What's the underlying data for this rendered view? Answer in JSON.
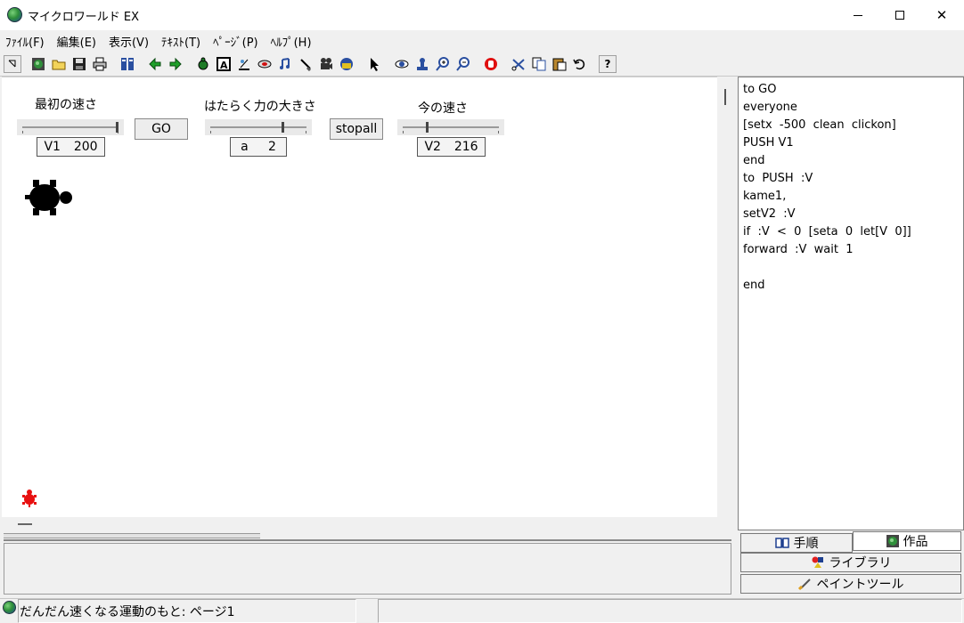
{
  "window": {
    "title": "マイクロワールド EX"
  },
  "menu": [
    "ﾌｧｲﾙ(F)",
    "編集(E)",
    "表示(V)",
    "ﾃｷｽﾄ(T)",
    "ﾍﾟｰｼﾞ(P)",
    "ﾍﾙﾌﾟ(H)"
  ],
  "toolbar": {
    "icons": [
      "pointer-back-icon",
      "globe-icon",
      "open-folder-icon",
      "save-icon",
      "print-icon",
      "pages-icon",
      "arrow-left-icon",
      "arrow-right-icon",
      "new-turtle-icon",
      "text-box-icon",
      "slider-tool-icon",
      "button-tool-icon",
      "music-icon",
      "paint-brush-icon",
      "video-icon",
      "record-icon",
      "select-arrow-icon",
      "eye-icon",
      "stamp-icon",
      "zoom-in-icon",
      "zoom-out-icon",
      "stop-icon",
      "scissors-icon",
      "copy-icon",
      "paste-icon",
      "undo-icon",
      "help-icon"
    ],
    "help_glyph": "?"
  },
  "canvas": {
    "slider1": {
      "label": "最初の速さ",
      "name": "V1",
      "value": "200",
      "level": 0.98
    },
    "go_button": "GO",
    "slider2": {
      "label": "はたらく力の大きさ",
      "name": "a",
      "value": "2",
      "level": 0.75
    },
    "stopall_button": "stopall",
    "slider3": {
      "label": "今の速さ",
      "name": "V2",
      "value": "216",
      "level": 0.25
    }
  },
  "procedures": [
    "to GO",
    "everyone",
    "[setx  -500  clean  clickon]",
    "PUSH V1",
    "end",
    "to  PUSH  :V",
    "kame1,",
    "setV2  :V",
    "if  :V  <  0  [seta  0  let[V  0]]",
    "forward  :V  wait  1",
    "",
    "end"
  ],
  "tabs": {
    "procedures_tab": "手順",
    "project_tab": "作品",
    "library_tab": "ライブラリ",
    "paint_tab": "ペイントツール"
  },
  "status": {
    "text": "だんだん速くなる運動のもと: ページ1"
  },
  "colors": {
    "turtle_main": "#000000",
    "turtle_small": "#e81010"
  }
}
